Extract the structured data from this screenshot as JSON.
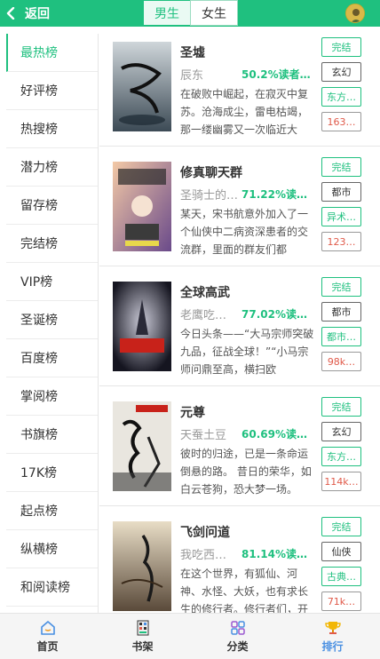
{
  "header": {
    "back_label": "返回",
    "tabs": [
      {
        "label": "男生",
        "active": true
      },
      {
        "label": "女生",
        "active": false
      }
    ]
  },
  "sidebar": {
    "items": [
      {
        "label": "最热榜",
        "active": true
      },
      {
        "label": "好评榜"
      },
      {
        "label": "热搜榜"
      },
      {
        "label": "潜力榜"
      },
      {
        "label": "留存榜"
      },
      {
        "label": "完结榜"
      },
      {
        "label": "VIP榜"
      },
      {
        "label": "圣诞榜"
      },
      {
        "label": "百度榜"
      },
      {
        "label": "掌阅榜"
      },
      {
        "label": "书旗榜"
      },
      {
        "label": "17K榜"
      },
      {
        "label": "起点榜"
      },
      {
        "label": "纵横榜"
      },
      {
        "label": "和阅读榜"
      }
    ]
  },
  "books": [
    {
      "title": "圣墟",
      "author": "辰东",
      "ratio": "50.2%读者存留",
      "desc": "在破败中崛起，在寂灭中复苏。沧海成尘，雷电枯竭，那一缕幽雾又一次临近大地，…",
      "status": "完结",
      "genre": "玄幻",
      "category": "东方…",
      "count": "163…"
    },
    {
      "title": "修真聊天群",
      "author": "圣骑士的…",
      "ratio": "71.22%读者…",
      "desc": "某天，宋书航意外加入了一个仙侠中二病资深患者的交流群，里面的群友们都以'道…",
      "status": "完结",
      "genre": "都市",
      "category": "异术…",
      "count": "123…"
    },
    {
      "title": "全球高武",
      "author": "老鹰吃…",
      "ratio": "77.02%读者…",
      "desc": "今日头条——“大马宗师突破九品，征战全球！”“小马宗师问鼎至高，横扫欧亚！”“乔…",
      "status": "完结",
      "genre": "都市",
      "category": "都市…",
      "count": "98k…"
    },
    {
      "title": "元尊",
      "author": "天蚕土豆",
      "ratio": "60.69%读者存留",
      "desc": "彼时的归途，已是一条命运倒悬的路。 昔日的荣华，如白云苍狗，恐大梦一场。 少…",
      "status": "完结",
      "genre": "玄幻",
      "category": "东方…",
      "count": "114k…"
    },
    {
      "title": "飞剑问道",
      "author": "我吃西…",
      "ratio": "81.14%读者…",
      "desc": "在这个世界，有狐仙、河神、水怪、大妖，也有求长生的修行者。修行者们，开法眼…",
      "status": "完结",
      "genre": "仙侠",
      "category": "古典…",
      "count": "71k…"
    }
  ],
  "bottom_nav": [
    {
      "label": "首页",
      "icon": "home-icon"
    },
    {
      "label": "书架",
      "icon": "bookshelf-icon"
    },
    {
      "label": "分类",
      "icon": "category-icon"
    },
    {
      "label": "排行",
      "icon": "trophy-icon",
      "active": true
    }
  ],
  "colors": {
    "accent": "#1fc07f",
    "count_red": "#e05a4a",
    "nav_active": "#4a90e2"
  }
}
